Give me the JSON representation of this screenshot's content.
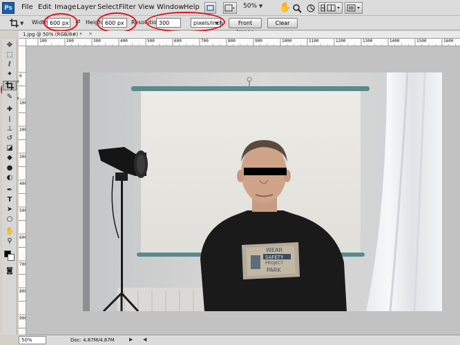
{
  "app": {
    "logo": "Ps"
  },
  "menu": {
    "items": [
      "File",
      "Edit",
      "Image",
      "Layer",
      "Select",
      "Filter",
      "View",
      "Window",
      "Help"
    ],
    "zoom": "50%"
  },
  "options": {
    "width_label": "Width:",
    "width_value": "600 px",
    "height_label": "Height:",
    "height_value": "600 px",
    "resolution_label": "Resolution:",
    "resolution_value": "300",
    "resolution_unit": "pixels/inch",
    "front_image": "Front Image",
    "clear": "Clear"
  },
  "document": {
    "tab_title": "1.jpg @ 50% (RGB/8#) *",
    "close": "×"
  },
  "rulers": {
    "top": [
      "0",
      "100",
      "200",
      "300",
      "400",
      "500",
      "600",
      "700",
      "800",
      "900",
      "1000",
      "1100",
      "1200",
      "1300",
      "1400",
      "1500",
      "1600"
    ],
    "left": [
      "0",
      "50",
      "100",
      "150",
      "200",
      "250",
      "300",
      "350",
      "400",
      "450",
      "500",
      "550",
      "600",
      "650",
      "700",
      "750",
      "800",
      "850",
      "900",
      "950"
    ]
  },
  "status": {
    "zoom": "50%",
    "doc": "Doc: 4.87M/4.87M"
  },
  "photo": {
    "shirt_lines": [
      "WEAR",
      "SAFETY",
      "PROJECT",
      "PARK"
    ]
  },
  "colors": {
    "annotation": "#e0121c",
    "pasteboard": "#c2c2c2",
    "ps_blue": "#1c5fa8"
  },
  "icons": {
    "tools": [
      "move-tool-icon",
      "marquee-tool-icon",
      "lasso-tool-icon",
      "quick-select-icon",
      "crop-tool-icon",
      "eyedropper-icon",
      "healing-brush-icon",
      "brush-icon",
      "clone-stamp-icon",
      "history-brush-icon",
      "eraser-icon",
      "paint-bucket-icon",
      "blur-icon",
      "dodge-icon",
      "pen-icon",
      "type-icon",
      "path-select-icon",
      "shape-icon",
      "hand-icon",
      "zoom-icon",
      "color-swatches-icon",
      "quick-mask-icon",
      "screen-mode-icon"
    ]
  }
}
